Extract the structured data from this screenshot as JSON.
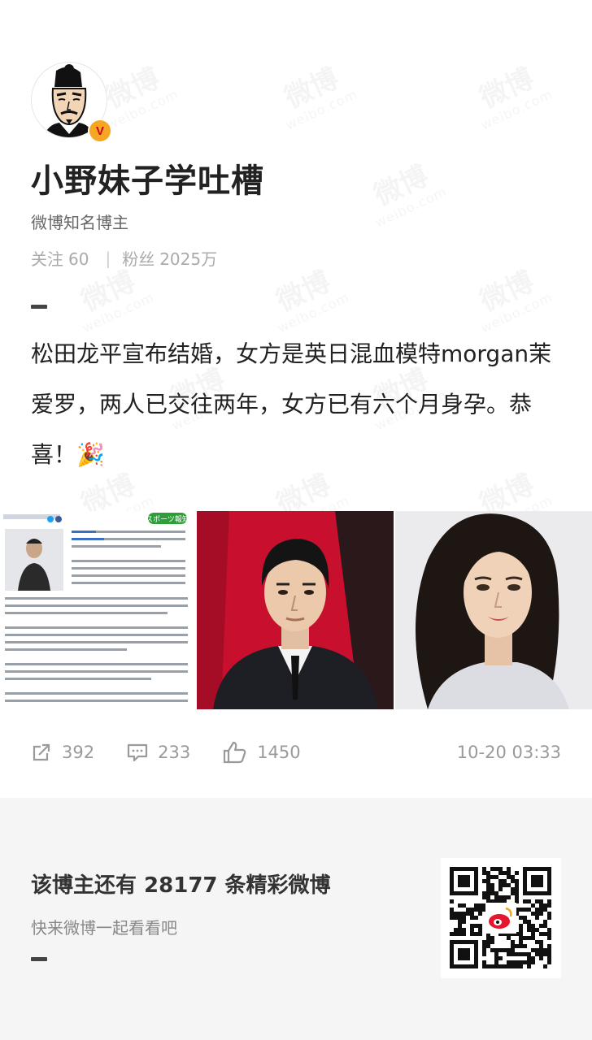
{
  "watermark": {
    "line1": "微博",
    "line2": "weibo.com"
  },
  "profile": {
    "name": "小野妹子学吐槽",
    "description": "微博知名博主",
    "verified_mark": "V",
    "following_label": "关注",
    "following_count": "60",
    "followers_label": "粉丝",
    "followers_count": "2025万"
  },
  "post": {
    "text": "松田龙平宣布结婚，女方是英日混血模特morgan茉爱罗，两人已交往两年，女方已有六个月身孕。恭喜！🎉",
    "images": [
      {
        "name": "news-article-screenshot",
        "masthead": "スポーツ報知"
      },
      {
        "name": "man-portrait-photo"
      },
      {
        "name": "woman-portrait-photo"
      }
    ]
  },
  "actions": {
    "repost_count": "392",
    "comment_count": "233",
    "like_count": "1450",
    "timestamp": "10-20 03:33"
  },
  "footer": {
    "title": "该博主还有 28177 条精彩微博",
    "subtitle": "快来微博一起看看吧"
  },
  "colors": {
    "background": "#ffffff",
    "footer_bg": "#f5f5f5",
    "verified_badge": "#f5a623",
    "text_primary": "#222222",
    "text_muted": "#aaaaaa"
  }
}
